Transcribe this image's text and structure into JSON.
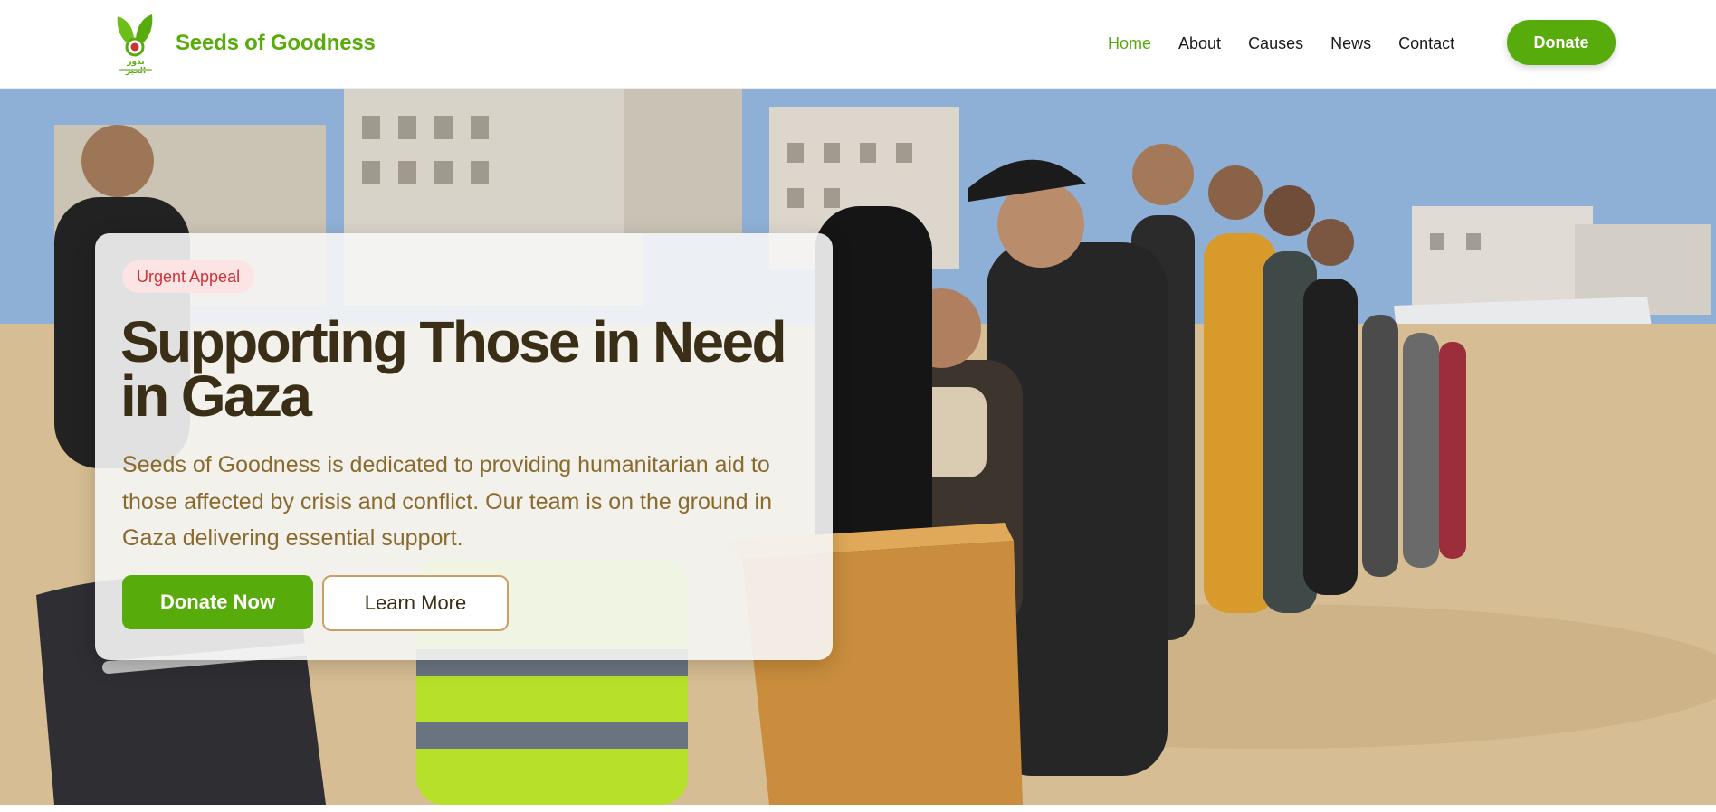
{
  "header": {
    "brand_name": "Seeds of Goodness",
    "logo_arabic": "بذور الخير",
    "logo_icon": "sprout-icon",
    "nav": [
      {
        "label": "Home",
        "active": true
      },
      {
        "label": "About",
        "active": false
      },
      {
        "label": "Causes",
        "active": false
      },
      {
        "label": "News",
        "active": false
      },
      {
        "label": "Contact",
        "active": false
      }
    ],
    "donate_label": "Donate"
  },
  "hero": {
    "badge": "Urgent Appeal",
    "title": "Supporting Those in Need in Gaza",
    "description": "Seeds of Goodness is dedicated to providing humanitarian aid to those affected by crisis and conflict. Our team is on the ground in Gaza delivering essential support.",
    "primary_button": "Donate Now",
    "secondary_button": "Learn More"
  },
  "colors": {
    "brand_green": "#57ab0b",
    "headline_brown": "#3a2e16",
    "body_brown": "#8a6a2e",
    "badge_bg": "#fde4e4",
    "badge_text": "#c8343a"
  }
}
